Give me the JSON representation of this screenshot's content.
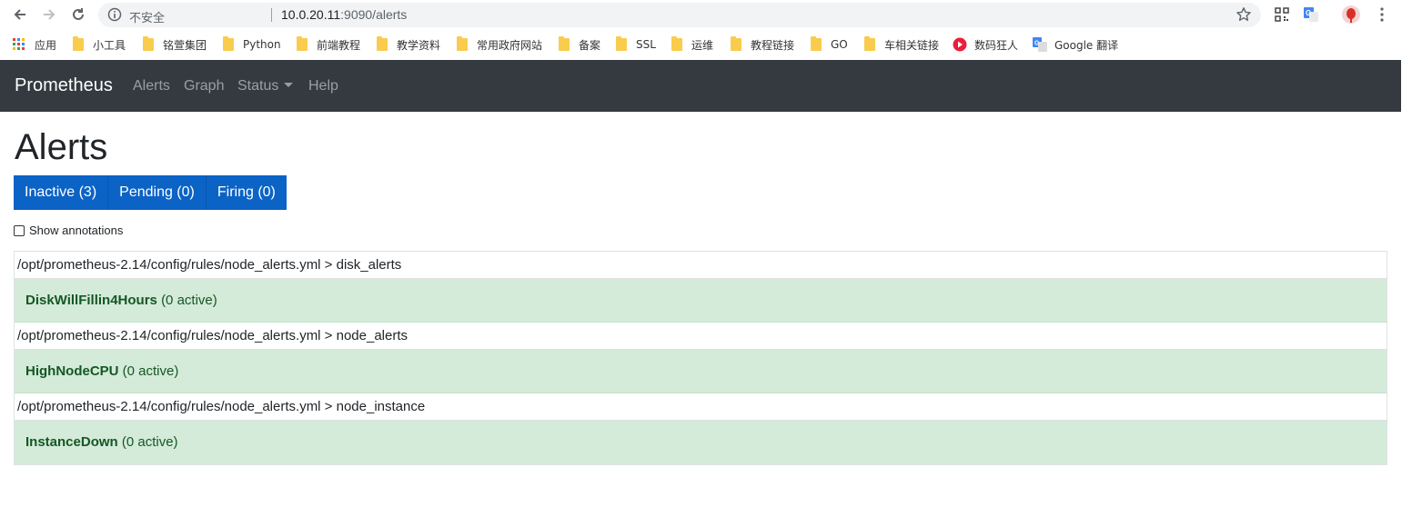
{
  "browser": {
    "security_label": "不安全",
    "url_host": "10.0.20.11",
    "url_rest": ":9090/alerts"
  },
  "bookmarks": [
    {
      "label": "应用",
      "icon": "apps-grid-icon"
    },
    {
      "label": "小工具",
      "icon": "folder-icon"
    },
    {
      "label": "铭萱集团",
      "icon": "folder-icon"
    },
    {
      "label": "Python",
      "icon": "folder-icon"
    },
    {
      "label": "前端教程",
      "icon": "folder-icon"
    },
    {
      "label": "教学资料",
      "icon": "folder-icon"
    },
    {
      "label": "常用政府网站",
      "icon": "folder-icon"
    },
    {
      "label": "备案",
      "icon": "folder-icon"
    },
    {
      "label": "SSL",
      "icon": "folder-icon"
    },
    {
      "label": "运维",
      "icon": "folder-icon"
    },
    {
      "label": "教程链接",
      "icon": "folder-icon"
    },
    {
      "label": "GO",
      "icon": "folder-icon"
    },
    {
      "label": "车相关链接",
      "icon": "folder-icon"
    },
    {
      "label": "数码狂人",
      "icon": "red-site-icon"
    },
    {
      "label": "Google 翻译",
      "icon": "google-translate-icon"
    }
  ],
  "navbar": {
    "brand": "Prometheus",
    "links": [
      "Alerts",
      "Graph",
      "Status",
      "Help"
    ]
  },
  "page": {
    "title": "Alerts",
    "filters": [
      "Inactive (3)",
      "Pending (0)",
      "Firing (0)"
    ],
    "show_annotations": "Show annotations"
  },
  "groups": [
    {
      "path": "/opt/prometheus-2.14/config/rules/node_alerts.yml > disk_alerts",
      "alert": "DiskWillFillin4Hours",
      "status": "(0 active)"
    },
    {
      "path": "/opt/prometheus-2.14/config/rules/node_alerts.yml > node_alerts",
      "alert": "HighNodeCPU",
      "status": "(0 active)"
    },
    {
      "path": "/opt/prometheus-2.14/config/rules/node_alerts.yml > node_instance",
      "alert": "InstanceDown",
      "status": "(0 active)"
    }
  ],
  "colors": {
    "navbar_bg": "#343a40",
    "button_blue": "#0b63c6",
    "alert_row_green": "#d4ebd9",
    "alert_text_green": "#155724"
  }
}
